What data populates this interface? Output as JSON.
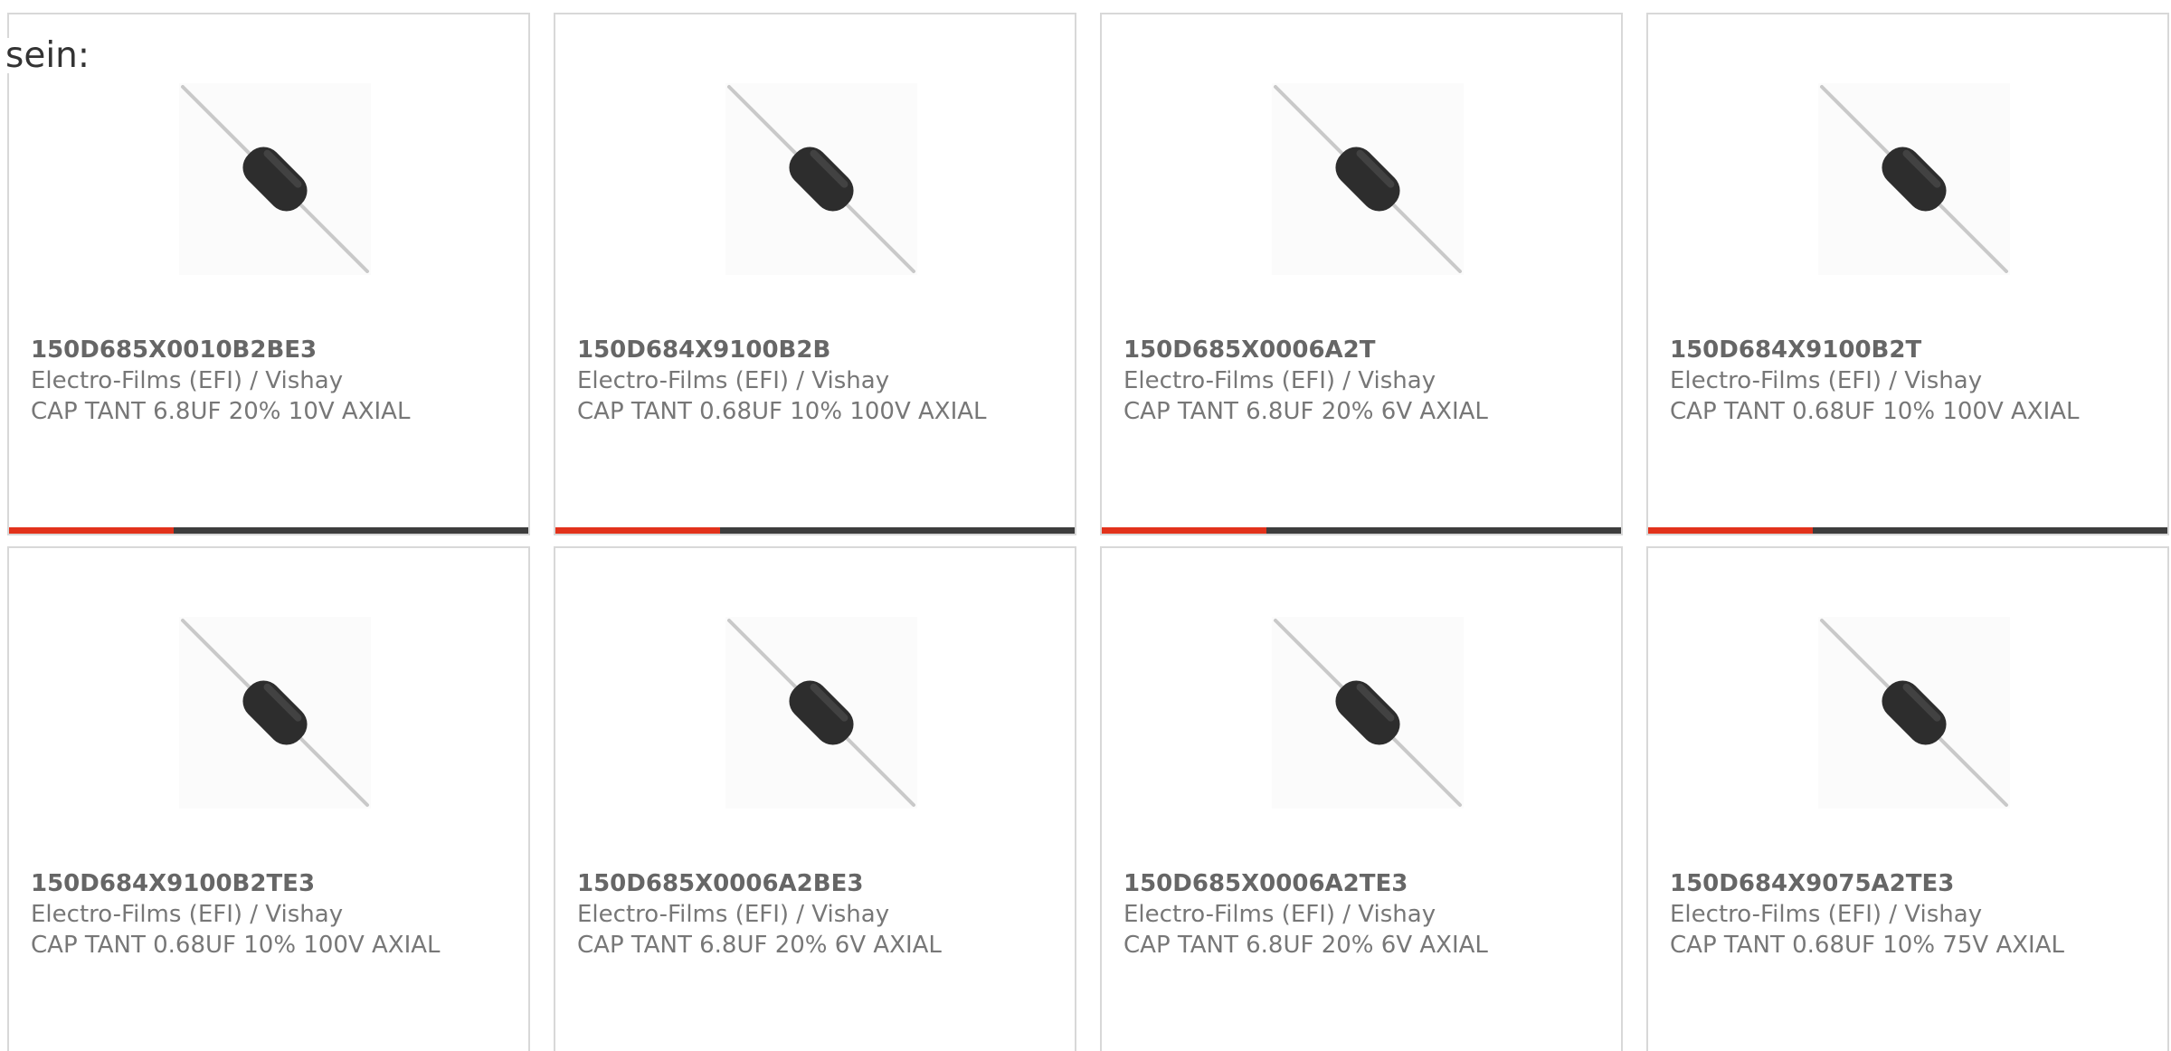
{
  "intro_text": "sein:",
  "colors": {
    "accent": "#e2321b",
    "bar": "#3d3d3d",
    "border": "#d8d8d8",
    "text": "#777777"
  },
  "products": [
    {
      "part_number": "150D685X0010B2BE3",
      "manufacturer": "Electro-Films (EFI) / Vishay",
      "description": "CAP TANT 6.8UF 20% 10V AXIAL",
      "image_icon": "axial-tantalum-capacitor-icon"
    },
    {
      "part_number": "150D684X9100B2B",
      "manufacturer": "Electro-Films (EFI) / Vishay",
      "description": "CAP TANT 0.68UF 10% 100V AXIAL",
      "image_icon": "axial-tantalum-capacitor-icon"
    },
    {
      "part_number": "150D685X0006A2T",
      "manufacturer": "Electro-Films (EFI) / Vishay",
      "description": "CAP TANT 6.8UF 20% 6V AXIAL",
      "image_icon": "axial-tantalum-capacitor-icon"
    },
    {
      "part_number": "150D684X9100B2T",
      "manufacturer": "Electro-Films (EFI) / Vishay",
      "description": "CAP TANT 0.68UF 10% 100V AXIAL",
      "image_icon": "axial-tantalum-capacitor-icon"
    },
    {
      "part_number": "150D684X9100B2TE3",
      "manufacturer": "Electro-Films (EFI) / Vishay",
      "description": "CAP TANT 0.68UF 10% 100V AXIAL",
      "image_icon": "axial-tantalum-capacitor-icon"
    },
    {
      "part_number": "150D685X0006A2BE3",
      "manufacturer": "Electro-Films (EFI) / Vishay",
      "description": "CAP TANT 6.8UF 20% 6V AXIAL",
      "image_icon": "axial-tantalum-capacitor-icon"
    },
    {
      "part_number": "150D685X0006A2TE3",
      "manufacturer": "Electro-Films (EFI) / Vishay",
      "description": "CAP TANT 6.8UF 20% 6V AXIAL",
      "image_icon": "axial-tantalum-capacitor-icon"
    },
    {
      "part_number": "150D684X9075A2TE3",
      "manufacturer": "Electro-Films (EFI) / Vishay",
      "description": "CAP TANT 0.68UF 10% 75V AXIAL",
      "image_icon": "axial-tantalum-capacitor-icon"
    }
  ]
}
